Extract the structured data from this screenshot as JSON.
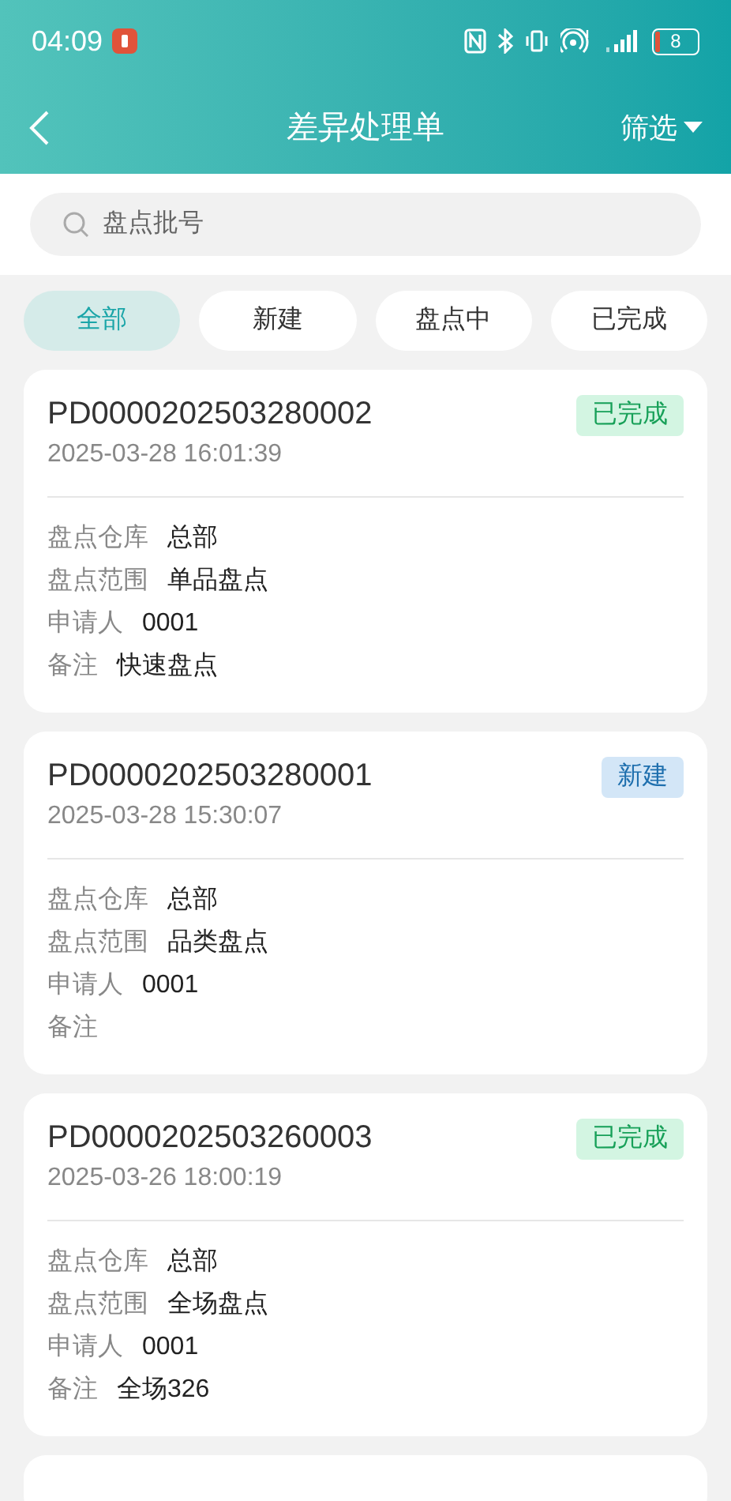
{
  "status_bar": {
    "time": "04:09",
    "battery": "8"
  },
  "header": {
    "title": "差异处理单",
    "filter": "筛选"
  },
  "search": {
    "placeholder": "盘点批号"
  },
  "tabs": [
    {
      "label": "全部",
      "selected": true
    },
    {
      "label": "新建",
      "selected": false
    },
    {
      "label": "盘点中",
      "selected": false
    },
    {
      "label": "已完成",
      "selected": false
    }
  ],
  "orders": [
    {
      "number": "PD0000202503280002",
      "time": "2025-03-28 16:01:39",
      "status": "已完成",
      "kind": "done",
      "fields": [
        {
          "label": "盘点仓库",
          "value": "总部"
        },
        {
          "label": "盘点范围",
          "value": "单品盘点"
        },
        {
          "label": "申请人",
          "value": "0001"
        },
        {
          "label": "备注",
          "value": "快速盘点"
        }
      ]
    },
    {
      "number": "PD0000202503280001",
      "time": "2025-03-28 15:30:07",
      "status": "新建",
      "kind": "new",
      "fields": [
        {
          "label": "盘点仓库",
          "value": "总部"
        },
        {
          "label": "盘点范围",
          "value": "品类盘点"
        },
        {
          "label": "申请人",
          "value": "0001"
        },
        {
          "label": "备注"
        }
      ]
    },
    {
      "number": "PD0000202503260003",
      "time": "2025-03-26 18:00:19",
      "status": "已完成",
      "kind": "done",
      "fields": [
        {
          "label": "盘点仓库",
          "value": "总部"
        },
        {
          "label": "盘点范围",
          "value": "全场盘点"
        },
        {
          "label": "申请人",
          "value": "0001"
        },
        {
          "label": "备注",
          "value": "全场326"
        }
      ]
    }
  ]
}
